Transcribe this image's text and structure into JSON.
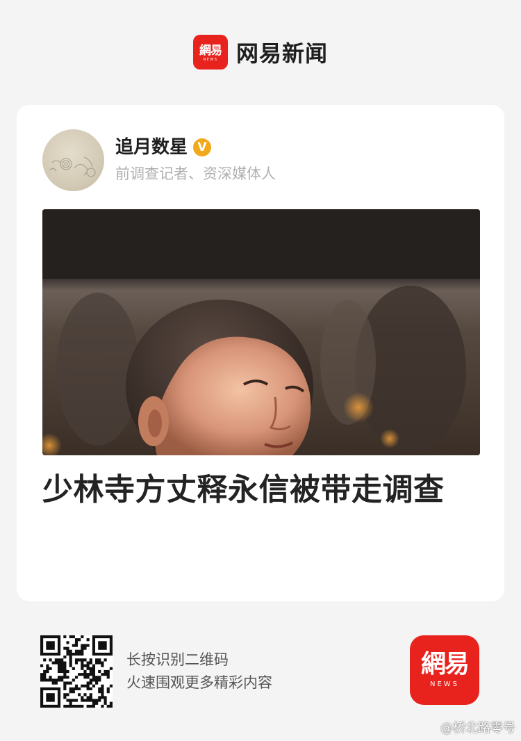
{
  "brand": {
    "logo_text": "網易",
    "logo_sub": "NEWS",
    "name": "网易新闻"
  },
  "card": {
    "author": {
      "name": "追月数星",
      "verified_mark": "V",
      "description": "前调查记者、资深媒体人"
    },
    "headline": "少林寺方丈释永信被带走调查"
  },
  "footer": {
    "qr_line1": "长按识别二维码",
    "qr_line2": "火速围观更多精彩内容",
    "logo_text": "網易",
    "logo_sub": "NEWS"
  },
  "watermark": "@桥北路零号",
  "colors": {
    "brand_red": "#e8231e",
    "verified_badge": "#f2a81b",
    "page_bg": "#f4f4f5",
    "card_bg": "#ffffff"
  },
  "icons": {
    "verified": "verified-badge-icon",
    "qr": "qr-code-icon"
  }
}
